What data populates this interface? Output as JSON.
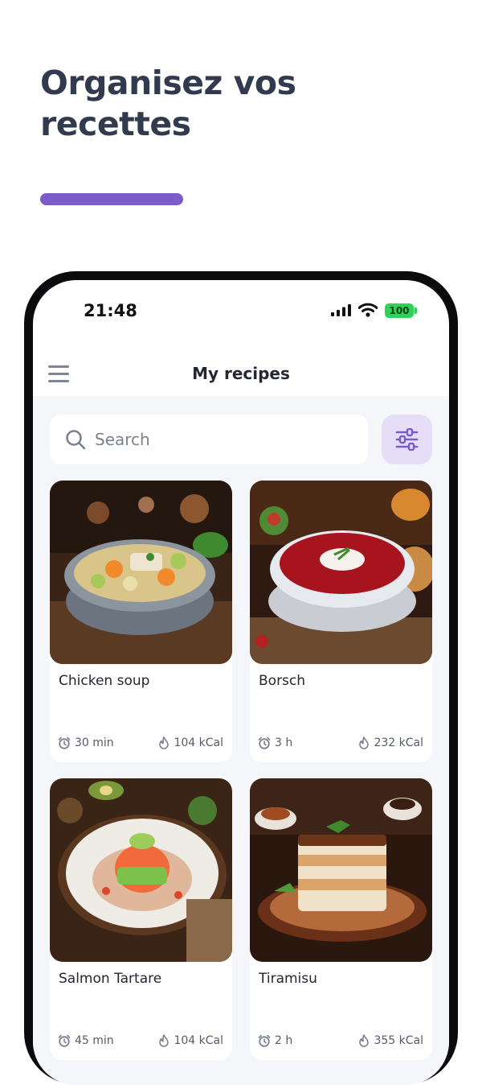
{
  "headline": {
    "line1": "Organisez vos",
    "line2": "recettes"
  },
  "colors": {
    "accent": "#7c5cc9",
    "filter_bg": "#e5def6",
    "battery": "#2fd158",
    "headline": "#323b4e"
  },
  "status_bar": {
    "time": "21:48",
    "battery": "100"
  },
  "app_bar": {
    "title": "My recipes",
    "menu_icon": "hamburger-icon"
  },
  "search": {
    "placeholder": "Search",
    "value": "",
    "icon": "search-icon"
  },
  "filter": {
    "icon": "sliders-icon"
  },
  "recipes": [
    {
      "title": "Chicken soup",
      "time": "30 min",
      "kcal": "104 kCal"
    },
    {
      "title": "Borsch",
      "time": "3 h",
      "kcal": "232 kCal"
    },
    {
      "title": "Salmon Tartare",
      "time": "45 min",
      "kcal": "104 kCal"
    },
    {
      "title": "Tiramisu",
      "time": "2 h",
      "kcal": "355 kCal"
    }
  ]
}
